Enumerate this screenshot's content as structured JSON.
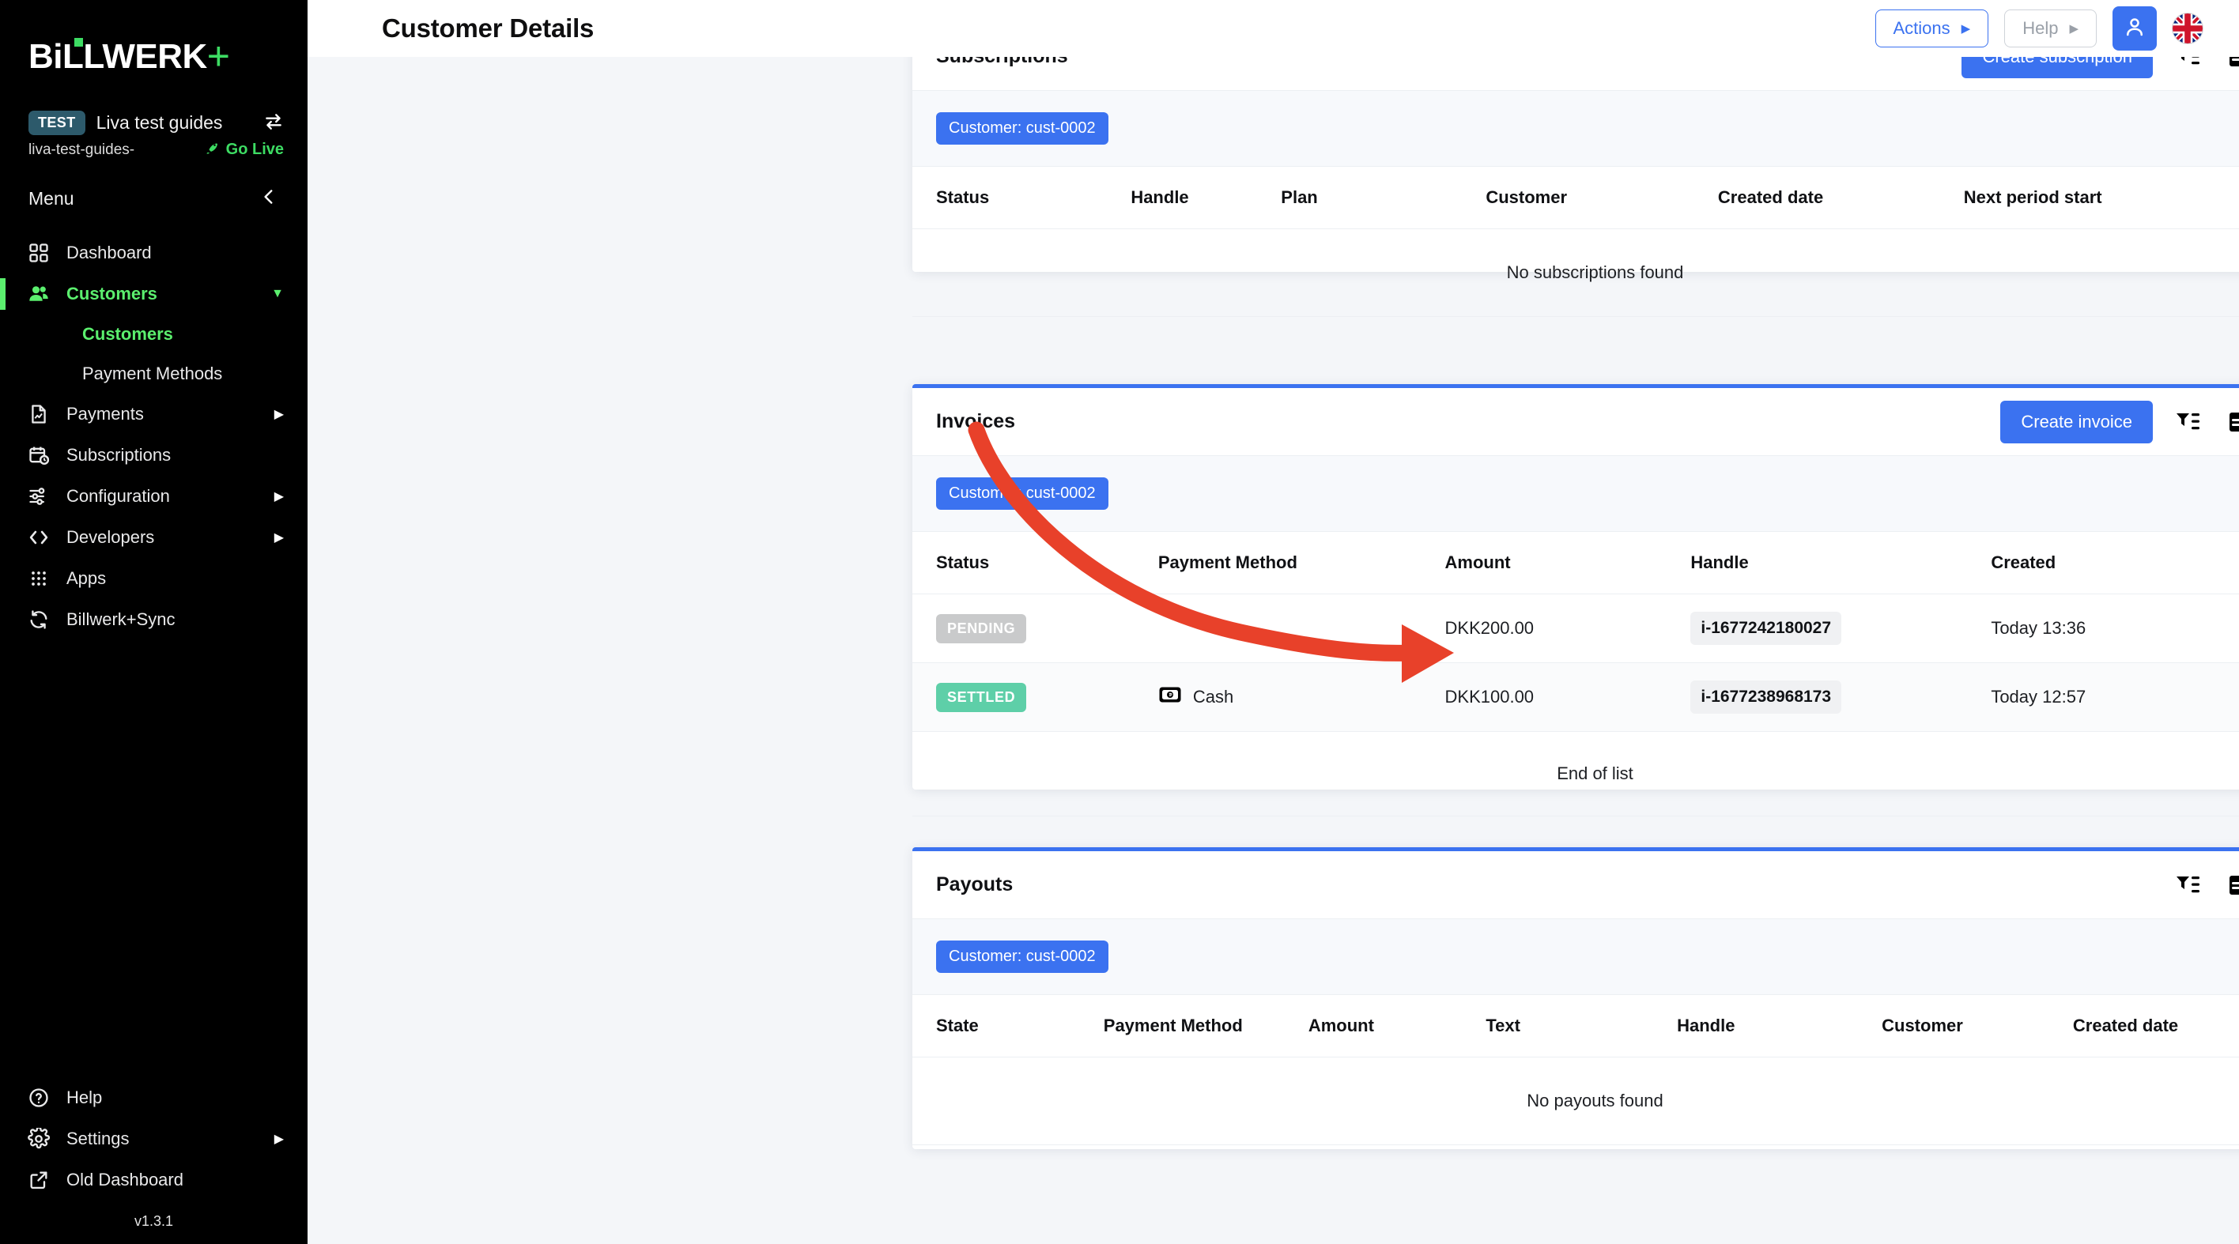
{
  "brand": {
    "logo_text": "BiLLWERK",
    "logo_plus": "+",
    "accent_green": "#3ddc63",
    "accent_blue": "#3b72f0"
  },
  "sidebar": {
    "env_badge": "TEST",
    "env_name": "Liva test guides",
    "env_handle": "liva-test-guides-",
    "go_live_label": "Go Live",
    "menu_label": "Menu",
    "version": "v1.3.1",
    "items": [
      {
        "label": "Dashboard",
        "icon": "grid-icon",
        "has_caret": false,
        "active": false
      },
      {
        "label": "Customers",
        "icon": "users-icon",
        "has_caret": true,
        "active": true
      },
      {
        "label": "Payments",
        "icon": "document-payment-icon",
        "has_caret": true,
        "active": false
      },
      {
        "label": "Subscriptions",
        "icon": "calendar-clock-icon",
        "has_caret": false,
        "active": false
      },
      {
        "label": "Configuration",
        "icon": "sliders-icon",
        "has_caret": true,
        "active": false
      },
      {
        "label": "Developers",
        "icon": "code-brackets-icon",
        "has_caret": true,
        "active": false
      },
      {
        "label": "Apps",
        "icon": "apps-grid-icon",
        "has_caret": false,
        "active": false
      },
      {
        "label": "Billwerk+Sync",
        "icon": "sync-icon",
        "has_caret": false,
        "active": false
      }
    ],
    "sub_items": [
      {
        "label": "Customers",
        "current": true
      },
      {
        "label": "Payment Methods",
        "current": false
      }
    ],
    "bottom_items": [
      {
        "label": "Help",
        "icon": "question-circle-icon",
        "has_caret": false
      },
      {
        "label": "Settings",
        "icon": "gear-icon",
        "has_caret": true
      },
      {
        "label": "Old Dashboard",
        "icon": "external-link-icon",
        "has_caret": false
      }
    ]
  },
  "topbar": {
    "title": "Customer Details",
    "actions_label": "Actions",
    "help_label": "Help"
  },
  "cards": {
    "subscriptions": {
      "title": "Subscriptions",
      "create_label": "Create subscription",
      "filter_chip": "Customer: cust-0002",
      "columns": [
        "Status",
        "Handle",
        "Plan",
        "Customer",
        "Created date",
        "Next period start"
      ],
      "empty_text": "No subscriptions found",
      "rows": []
    },
    "invoices": {
      "title": "Invoices",
      "create_label": "Create invoice",
      "filter_chip": "Customer: cust-0002",
      "columns": [
        "Status",
        "Payment Method",
        "Amount",
        "Handle",
        "Created"
      ],
      "end_text": "End of list",
      "rows": [
        {
          "status": "PENDING",
          "status_kind": "pending",
          "payment_method": "",
          "payment_icon": "",
          "amount": "DKK200.00",
          "handle": "i-1677242180027",
          "created": "Today 13:36"
        },
        {
          "status": "SETTLED",
          "status_kind": "settled",
          "payment_method": "Cash",
          "payment_icon": "cash-banknote-icon",
          "amount": "DKK100.00",
          "handle": "i-1677238968173",
          "created": "Today 12:57"
        }
      ]
    },
    "payouts": {
      "title": "Payouts",
      "filter_chip": "Customer: cust-0002",
      "columns": [
        "State",
        "Payment Method",
        "Amount",
        "Text",
        "Handle",
        "Customer",
        "Created date"
      ],
      "empty_text": "No payouts found",
      "rows": []
    }
  },
  "annotation": {
    "arrow_color": "#e8412a",
    "points_to": "i-1677242180027"
  }
}
